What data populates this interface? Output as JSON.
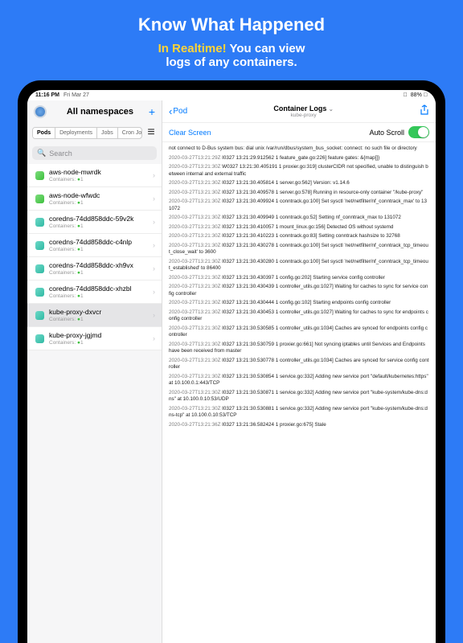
{
  "promo": {
    "title": "Know What Happened",
    "realtime": "In Realtime!",
    "desc1": " You can view",
    "desc2": "logs of any containers."
  },
  "status": {
    "time": "11:16 PM",
    "date": "Fri Mar 27"
  },
  "sidebar": {
    "title": "All namespaces",
    "plus": "+",
    "tabs": {
      "pods": "Pods",
      "deployments": "Deployments",
      "jobs": "Jobs",
      "cron": "Cron Jobs"
    },
    "search_placeholder": "Search",
    "pods": [
      {
        "name": "aws-node-mwrdk",
        "sub": "Containers:",
        "count": "1",
        "icon": "g"
      },
      {
        "name": "aws-node-wfwdc",
        "sub": "Containers:",
        "count": "1",
        "icon": "g"
      },
      {
        "name": "coredns-74dd858ddc-59v2k",
        "sub": "Containers:",
        "count": "1",
        "icon": "t"
      },
      {
        "name": "coredns-74dd858ddc-c4nlp",
        "sub": "Containers:",
        "count": "1",
        "icon": "t"
      },
      {
        "name": "coredns-74dd858ddc-xh9vx",
        "sub": "Containers:",
        "count": "1",
        "icon": "t"
      },
      {
        "name": "coredns-74dd858ddc-xhzbl",
        "sub": "Containers:",
        "count": "1",
        "icon": "t"
      },
      {
        "name": "kube-proxy-dxvcr",
        "sub": "Containers:",
        "count": "1",
        "icon": "t"
      },
      {
        "name": "kube-proxy-jgjmd",
        "sub": "Containers:",
        "count": "1",
        "icon": "t"
      }
    ]
  },
  "main": {
    "back": "Pod",
    "title": "Container Logs",
    "subtitle": "kube-proxy",
    "clear": "Clear Screen",
    "autoscroll": "Auto Scroll"
  },
  "logs": [
    "not connect to D-Bus system bus: dial unix /var/run/dbus/system_bus_socket: connect: no such file or directory",
    "2020-03-27T13:21:29Z I0327 13:21:29.912562       1 feature_gate.go:226] feature gates: &{map[]}",
    "2020-03-27T13:21:30Z W0327 13:21:30.405191       1 proxier.go:319] clusterCIDR not specified, unable to distinguish between internal and external traffic",
    "2020-03-27T13:21:30Z I0327 13:21:30.405814       1 server.go:562] Version: v1.14.6",
    "2020-03-27T13:21:30Z I0327 13:21:30.409578       1 server.go:578] Running in resource-only container \"/kube-proxy\"",
    "2020-03-27T13:21:30Z I0327 13:21:30.409924       1 conntrack.go:100] Set sysctl 'net/netfilter/nf_conntrack_max' to 131072",
    "2020-03-27T13:21:30Z I0327 13:21:30.409949       1 conntrack.go:52] Setting nf_conntrack_max to 131072",
    "2020-03-27T13:21:30Z I0327 13:21:30.410057       1 mount_linux.go:156] Detected OS without systemd",
    "2020-03-27T13:21:30Z I0327 13:21:30.410223       1 conntrack.go:83] Setting conntrack hashsize to 32768",
    "2020-03-27T13:21:30Z I0327 13:21:30.430278       1 conntrack.go:100] Set sysctl 'net/netfilter/nf_conntrack_tcp_timeout_close_wait' to 3600",
    "2020-03-27T13:21:30Z I0327 13:21:30.430280       1 conntrack.go:100] Set sysctl 'net/netfilter/nf_conntrack_tcp_timeout_established' to 86400",
    "2020-03-27T13:21:30Z I0327 13:21:30.430397       1 config.go:202] Starting service config controller",
    "2020-03-27T13:21:30Z I0327 13:21:30.430439       1 controller_utils.go:1027] Waiting for caches to sync for service config controller",
    "2020-03-27T13:21:30Z I0327 13:21:30.430444       1 config.go:102] Starting endpoints config controller",
    "2020-03-27T13:21:30Z I0327 13:21:30.430453       1 controller_utils.go:1027] Waiting for caches to sync for endpoints config controller",
    "2020-03-27T13:21:30Z I0327 13:21:30.530585       1 controller_utils.go:1034] Caches are synced for endpoints config controller",
    "2020-03-27T13:21:30Z I0327 13:21:30.530759       1 proxier.go:661] Not syncing iptables until Services and Endpoints have been received from master",
    "2020-03-27T13:21:30Z I0327 13:21:30.530778       1 controller_utils.go:1034] Caches are synced for service config controller",
    "2020-03-27T13:21:30Z I0327 13:21:30.530854       1 service.go:332] Adding new service port \"default/kubernetes:https\" at 10.100.0.1:443/TCP",
    "2020-03-27T13:21:30Z I0327 13:21:30.530871       1 service.go:332] Adding new service port \"kube-system/kube-dns:dns\" at 10.100.0.10:53/UDP",
    "2020-03-27T13:21:30Z I0327 13:21:30.530881       1 service.go:332] Adding new service port \"kube-system/kube-dns:dns-tcp\" at 10.100.0.10:53/TCP",
    "2020-03-27T13:21:36Z I0327 13:21:36.582424       1 proxier.go:675] Stale"
  ]
}
